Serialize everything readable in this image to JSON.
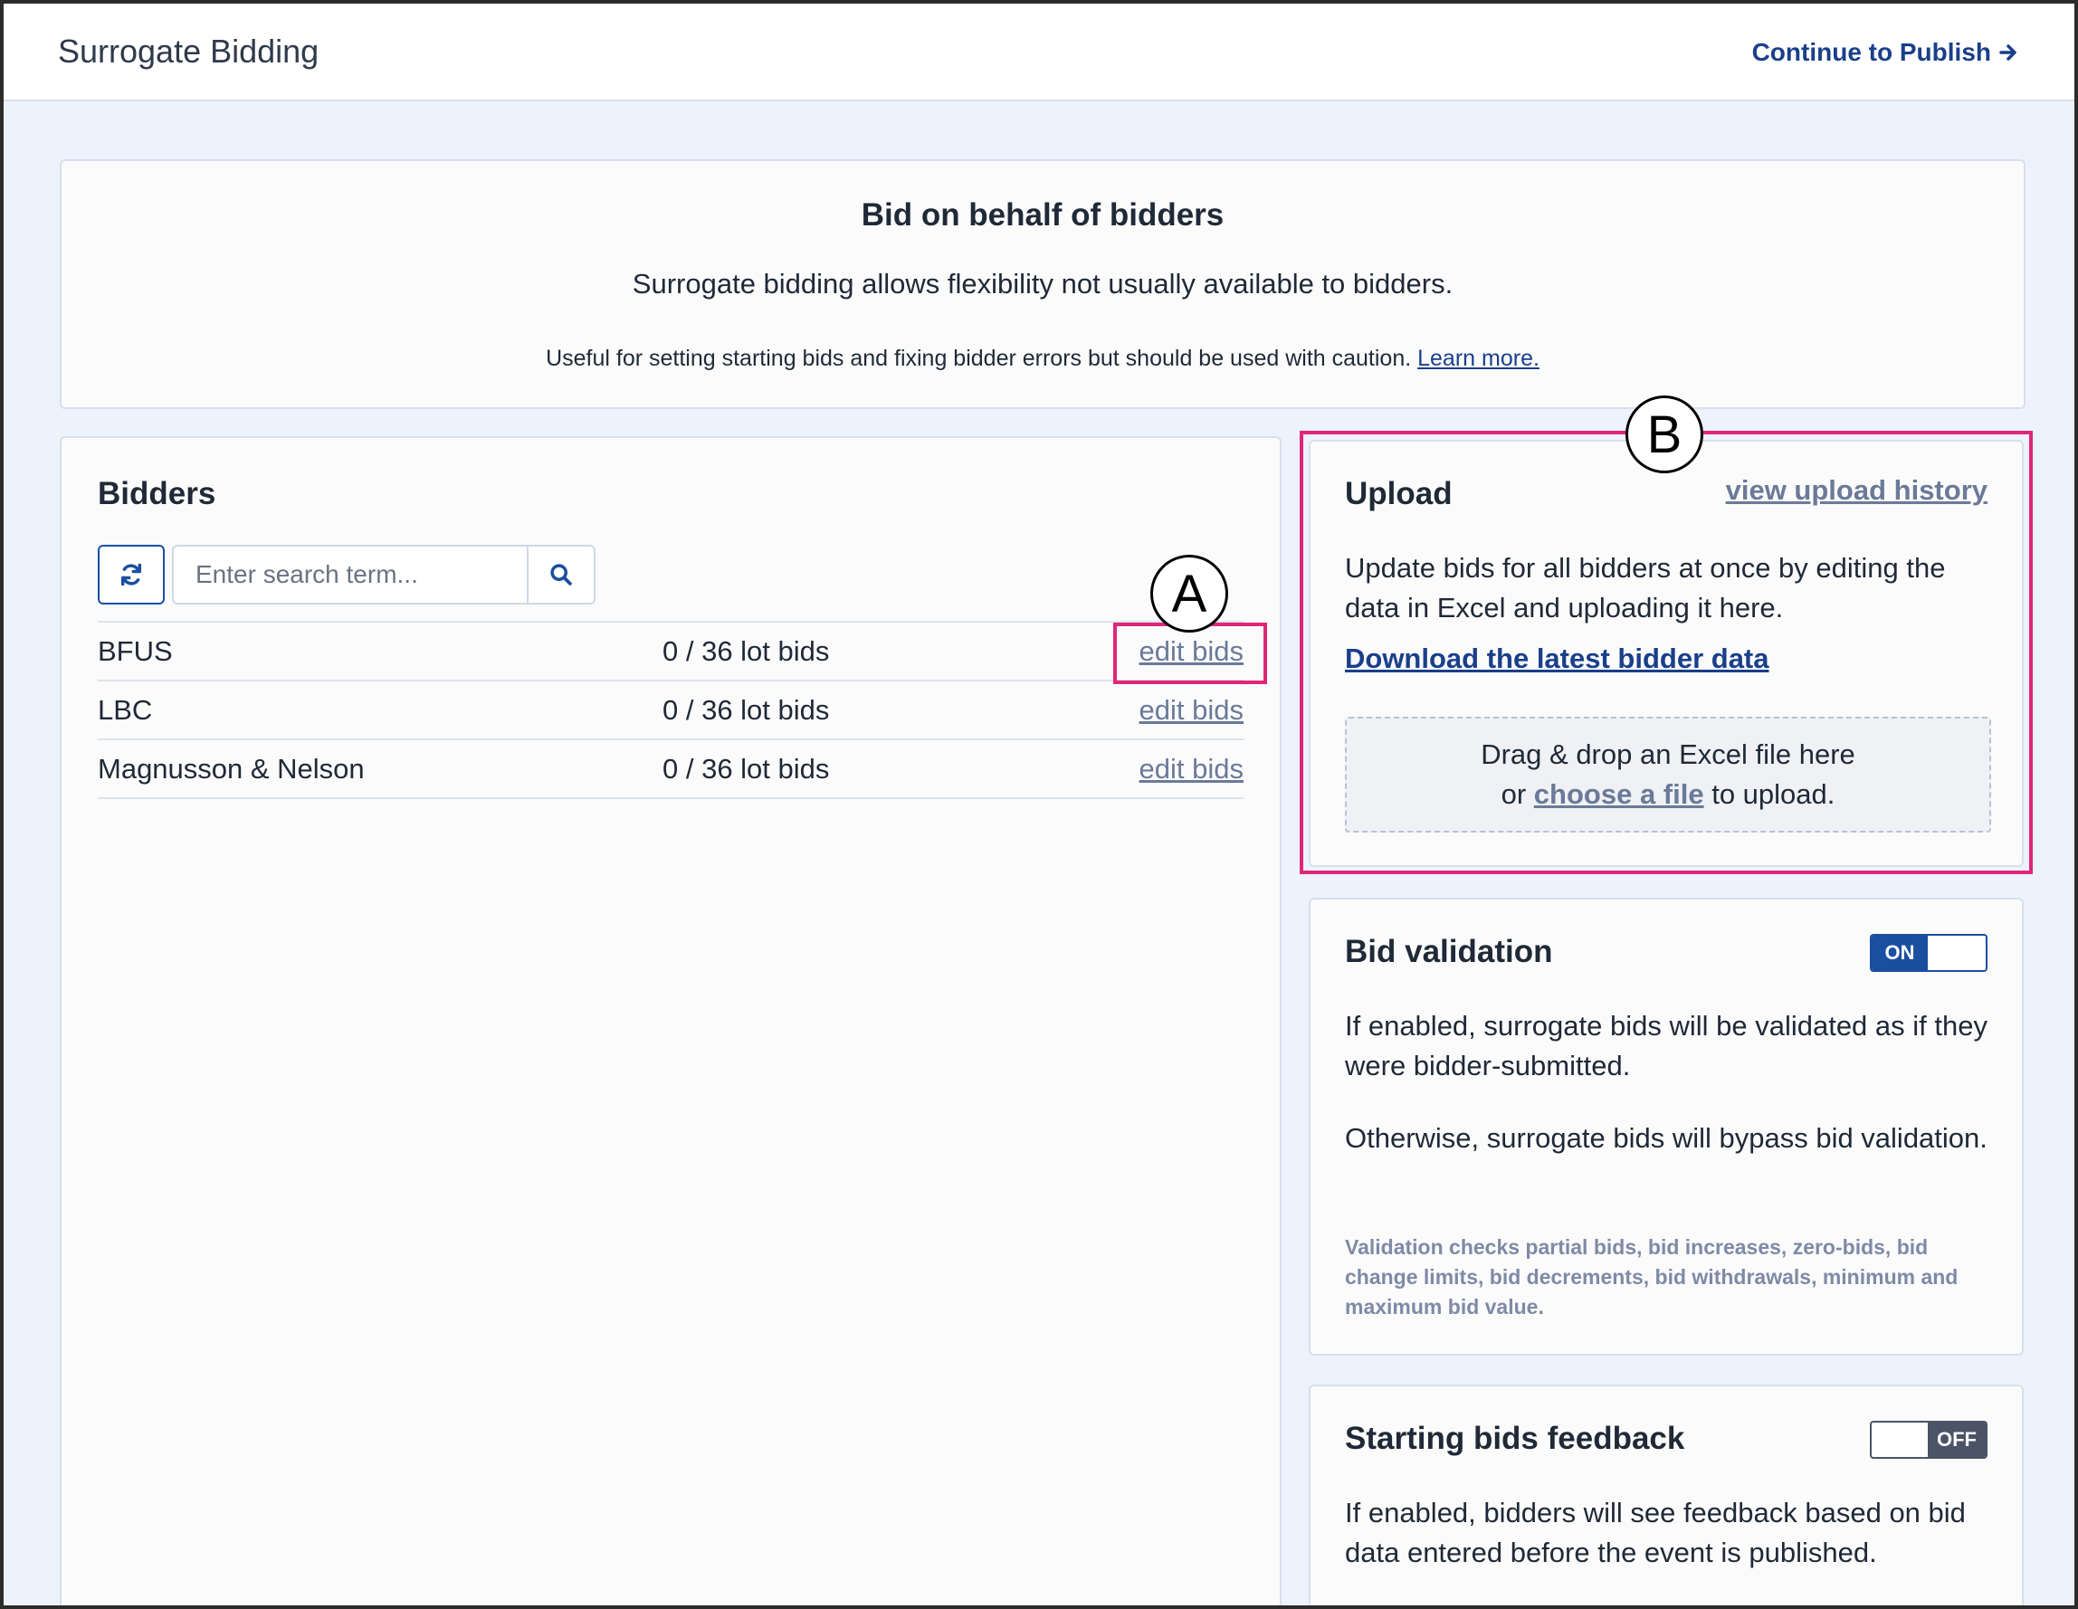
{
  "header": {
    "title": "Surrogate Bidding",
    "continue_label": "Continue to Publish"
  },
  "intro": {
    "heading": "Bid on behalf of bidders",
    "lead": "Surrogate bidding allows flexibility not usually available to bidders.",
    "note": "Useful for setting starting bids and fixing bidder errors but should be used with caution.",
    "learn_more": "Learn more."
  },
  "bidders": {
    "heading": "Bidders",
    "search_placeholder": "Enter search term...",
    "rows": [
      {
        "name": "BFUS",
        "count": "0 / 36 lot bids",
        "action": "edit bids"
      },
      {
        "name": "LBC",
        "count": "0 / 36 lot bids",
        "action": "edit bids"
      },
      {
        "name": "Magnusson & Nelson",
        "count": "0 / 36 lot bids",
        "action": "edit bids"
      }
    ]
  },
  "upload": {
    "heading": "Upload",
    "history_link": "view upload history",
    "description": "Update bids for all bidders at once by editing the data in Excel and uploading it here.",
    "download_link": "Download the latest bidder data",
    "drop_line1": "Drag & drop an Excel file here",
    "drop_or": "or",
    "drop_choose": "choose a file",
    "drop_suffix": "to upload."
  },
  "validation": {
    "heading": "Bid validation",
    "toggle": "ON",
    "text1": "If enabled, surrogate bids will be validated as if they were bidder-submitted.",
    "text2": "Otherwise, surrogate bids will bypass bid validation.",
    "note": "Validation checks partial bids, bid increases, zero-bids, bid change limits, bid decrements, bid withdrawals, minimum and maximum bid value."
  },
  "feedback": {
    "heading": "Starting bids feedback",
    "toggle": "OFF",
    "text": "If enabled, bidders will see feedback based on bid data entered before the event is published."
  },
  "callouts": {
    "a": "A",
    "b": "B"
  },
  "icons": {
    "refresh": "refresh-icon",
    "search": "search-icon",
    "arrow": "arrow-right-icon"
  },
  "colors": {
    "accent": "#1a3f8a",
    "toggle_on": "#1a4fa0",
    "toggle_off": "#4a5466",
    "highlight": "#e0267a",
    "background": "#edf3fc"
  }
}
